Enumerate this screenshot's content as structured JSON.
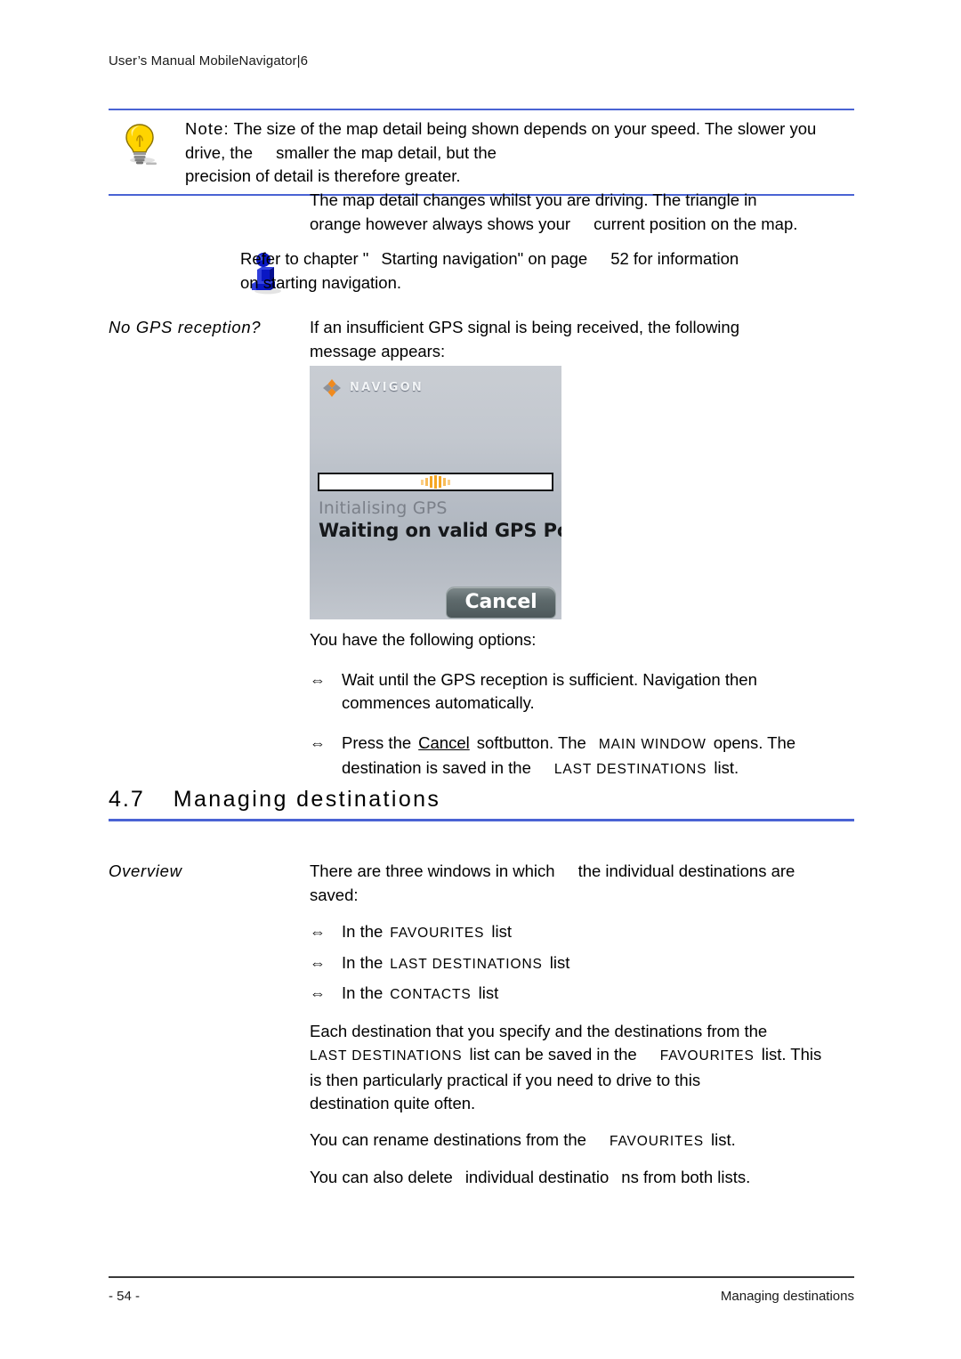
{
  "header": {
    "running_head": "User’s Manual MobileNavigator|6"
  },
  "note_box": {
    "icon": "lightbulb-icon",
    "label": "Note:",
    "text": " The size of the map detail being shown depends on your speed. The slower you drive, the"
  },
  "note_box_cont": {
    "text_a": "smaller the map detail, but the",
    "text_b": "precision of detail is therefore greater."
  },
  "paragraph_map_detail": {
    "line1": "The map detail changes whilst you are driving. The triangle in",
    "line2a": "orange however always shows your",
    "line2b": "current position on the map."
  },
  "tip_block": {
    "icon": "info-figure-icon",
    "line1a": "Refer to chapter \"",
    "line1b": "Starting navigation\" on page",
    "line1c": "52 for information",
    "line2": "on starting navigation."
  },
  "gps_section": {
    "gutter_label": "No GPS reception?",
    "line1": "If an insufficient GPS signal is being received, the following",
    "line2": "message appears:"
  },
  "device_screenshot": {
    "brand": "NAVIGON",
    "status_primary": "Initialising GPS",
    "status_secondary": "Waiting on valid GPS Position",
    "cancel_label": "Cancel",
    "progress_state": "indeterminate",
    "accent_color": "#f5a623"
  },
  "options": {
    "intro": "You have the following options:",
    "bullet_mark": "⇔",
    "items": [
      {
        "line1": "Wait until the GPS reception is sufficient. Navigation then",
        "line2": "commences automatically."
      }
    ],
    "cancel_bullet": {
      "seg1": "Press the",
      "button": "Cancel",
      "seg2": "softbutton. The",
      "window_name": "Main Window",
      "seg3": "opens. The",
      "seg4": "destination is saved in the",
      "list_name": "Last Destinations",
      "seg5": "list."
    }
  },
  "section_heading": {
    "number": "4.7",
    "title": "Managing destinations",
    "rule_color": "#4a63d4"
  },
  "overview": {
    "gutter_label": "Overview",
    "intro_a": "There are three windows in which",
    "intro_b": "the individual destinations are",
    "intro_c": "saved:",
    "bullet_mark": "⇔",
    "list_items": [
      {
        "prefix": "In the",
        "name": "Favourites",
        "suffix": "list"
      },
      {
        "prefix": "In the",
        "name": "Last Destinations",
        "suffix": "list"
      },
      {
        "prefix": "In the",
        "name": "Contacts",
        "suffix": "list"
      }
    ],
    "para1_l1": "Each destination that you specify and the destinations from the",
    "para1_l2_name": "Last Destinations",
    "para1_l2_a": "list can be saved in the",
    "para1_l2_name2": "Favourites",
    "para1_l2_b": "list. This",
    "para1_l3": "is then particularly practical if you need to drive to this",
    "para1_l4": "destination quite often.",
    "para2_a": "You can rename destinations from the",
    "para2_name": "Favourites",
    "para2_b": "list.",
    "para3_a": "You can also delete",
    "para3_b": "individual destinatio",
    "para3_c": "ns from both lists."
  },
  "footer": {
    "page_number": "- 54 -",
    "section_name": "Managing destinations"
  }
}
